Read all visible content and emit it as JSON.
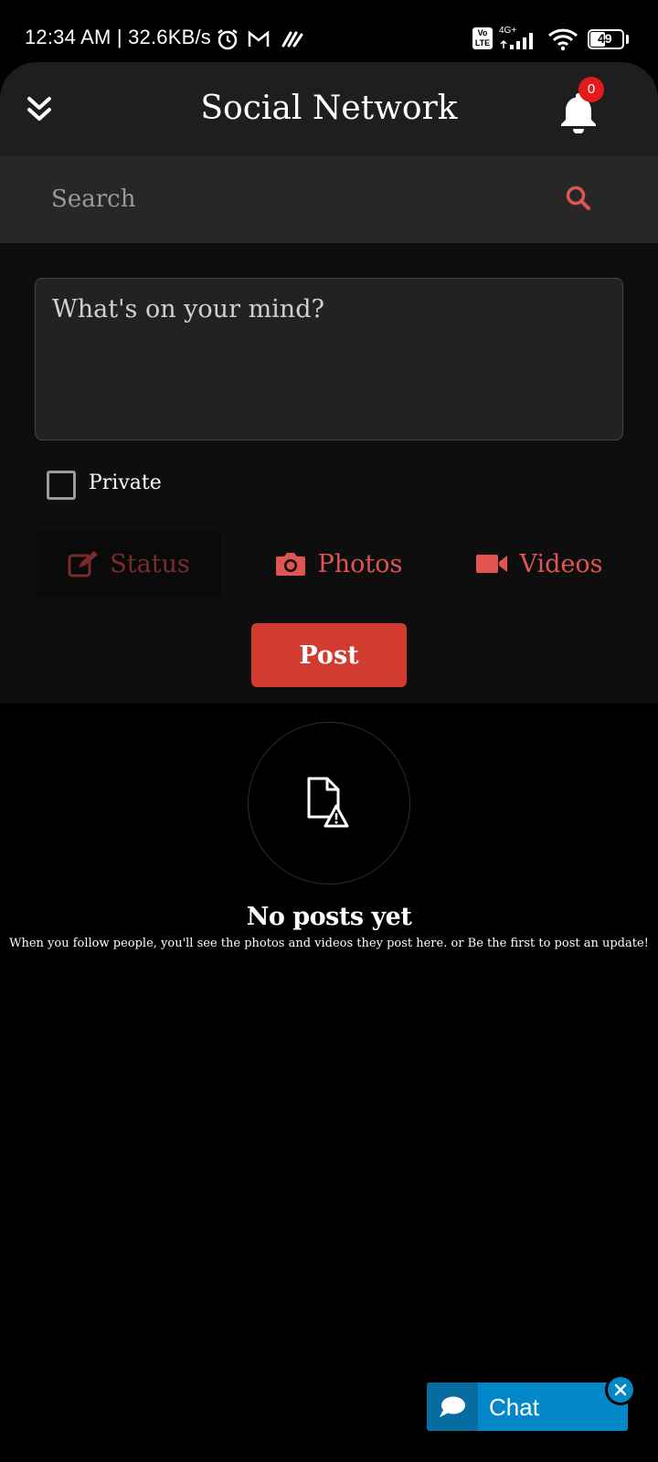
{
  "status_bar": {
    "time_speed": "12:34 AM | 32.6KB/s",
    "network": "4G+",
    "volte": "Vo LTE",
    "battery": "49"
  },
  "header": {
    "title": "Social Network",
    "notification_count": "0"
  },
  "search": {
    "placeholder": "Search"
  },
  "composer": {
    "placeholder": "What's on your mind?",
    "private_label": "Private",
    "tabs": [
      {
        "label": "Status",
        "icon": "edit-icon"
      },
      {
        "label": "Photos",
        "icon": "camera-icon"
      },
      {
        "label": "Videos",
        "icon": "video-icon"
      }
    ],
    "post_label": "Post"
  },
  "empty_state": {
    "title": "No posts yet",
    "subtitle": "When you follow people, you'll see the photos and videos they post here. or Be the first to post an update!"
  },
  "chat": {
    "label": "Chat"
  },
  "colors": {
    "accent": "#e05452",
    "post_button": "#d23b2f",
    "chat": "#0288c9",
    "badge": "#e11b1b"
  }
}
